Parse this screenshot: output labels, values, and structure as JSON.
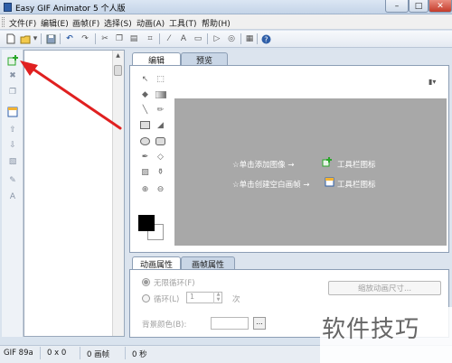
{
  "window": {
    "title": "Easy GIF Animator 5 个人版",
    "minimize": "–",
    "maximize": "□",
    "close": "✕"
  },
  "menu": {
    "items": [
      "文件(F)",
      "编辑(E)",
      "画帧(F)",
      "选择(S)",
      "动画(A)",
      "工具(T)",
      "帮助(H)"
    ]
  },
  "editor": {
    "tabs": [
      "编辑",
      "预览"
    ],
    "hint_add_image": "☆单击添加图像 →",
    "hint_add_blank": "☆单击创建空白画帧 →",
    "toolbar_icon_label": "工具栏图标"
  },
  "properties": {
    "tabs": [
      "动画属性",
      "画帧属性"
    ],
    "infinite_loop": "无限循环(F)",
    "loop": "循环(L)",
    "loop_count": "1",
    "times": "次",
    "background_color": "背景颜色(B):",
    "browse": "...",
    "resize_button": "缩放动画尺寸..."
  },
  "status": {
    "format": "GIF 89a",
    "size": "0 x 0",
    "frames": "0 画帧",
    "duration": "0 秒"
  },
  "watermark": "软件技巧",
  "colors": {
    "canvas": "#a8a8a8",
    "arrow": "#e02020",
    "accent_green": "#2aa62a",
    "accent_yellow": "#f2b233"
  }
}
